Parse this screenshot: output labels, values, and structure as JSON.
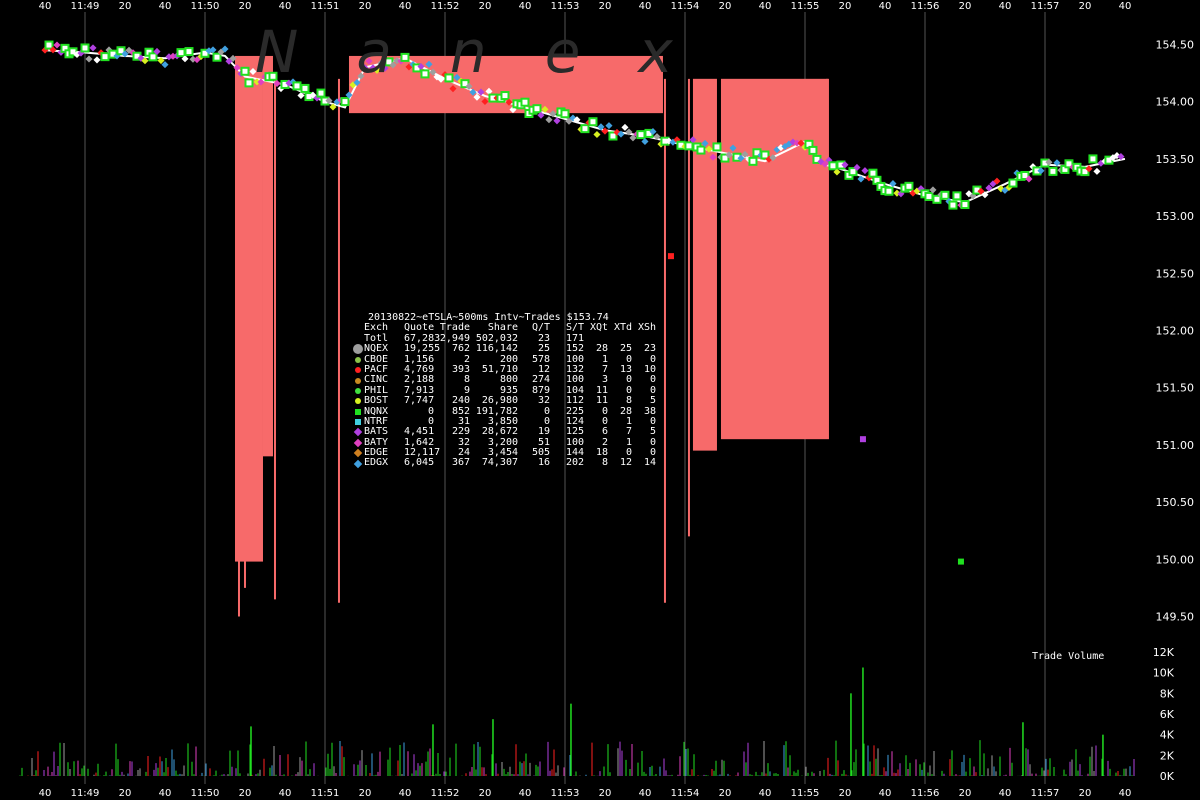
{
  "watermark": "Nanex",
  "volume_label": "Trade Volume",
  "x_ticks": [
    "40",
    "11:49",
    "20",
    "40",
    "11:50",
    "20",
    "40",
    "11:51",
    "20",
    "40",
    "11:52",
    "20",
    "40",
    "11:53",
    "20",
    "40",
    "11:54",
    "20",
    "40",
    "11:55",
    "20",
    "40",
    "11:56",
    "20",
    "40",
    "11:57",
    "20",
    "40"
  ],
  "price_ticks": [
    "154.50",
    "154.00",
    "153.50",
    "153.00",
    "152.50",
    "152.00",
    "151.50",
    "151.00",
    "150.50",
    "150.00",
    "149.50"
  ],
  "volume_ticks": [
    "12K",
    "10K",
    "8K",
    "6K",
    "4K",
    "2K",
    "0K"
  ],
  "stats": {
    "title": "20130822~eTSLA~500ms Intv~Trades $153.74",
    "header": [
      "Exch",
      "Quote",
      "Trade",
      "Share",
      "Q/T",
      "S/T",
      "XQt",
      "XTd",
      "XSh"
    ],
    "rows": [
      {
        "icon": "none",
        "color": "",
        "cells": [
          "Totl",
          "67,283",
          "2,949",
          "502,032",
          "23",
          "171",
          "",
          "",
          ""
        ]
      },
      {
        "icon": "circle-large",
        "color": "#9e9e9e",
        "cells": [
          "NQEX",
          "19,255",
          "762",
          "116,142",
          "25",
          "152",
          "28",
          "25",
          "23"
        ]
      },
      {
        "icon": "circle",
        "color": "#8bc34a",
        "cells": [
          "CBOE",
          "1,156",
          "2",
          "200",
          "578",
          "100",
          "1",
          "0",
          "0"
        ]
      },
      {
        "icon": "circle",
        "color": "#ff2020",
        "cells": [
          "PACF",
          "4,769",
          "393",
          "51,710",
          "12",
          "132",
          "7",
          "13",
          "10"
        ]
      },
      {
        "icon": "circle",
        "color": "#c88a20",
        "cells": [
          "CINC",
          "2,188",
          "8",
          "800",
          "274",
          "100",
          "3",
          "0",
          "0"
        ]
      },
      {
        "icon": "circle",
        "color": "#40e040",
        "cells": [
          "PHIL",
          "7,913",
          "9",
          "935",
          "879",
          "104",
          "11",
          "0",
          "0"
        ]
      },
      {
        "icon": "circle",
        "color": "#d8f020",
        "cells": [
          "BOST",
          "7,747",
          "240",
          "26,980",
          "32",
          "112",
          "11",
          "8",
          "5"
        ]
      },
      {
        "icon": "square",
        "color": "#20e020",
        "cells": [
          "NQNX",
          "0",
          "852",
          "191,782",
          "0",
          "225",
          "0",
          "28",
          "38"
        ]
      },
      {
        "icon": "square",
        "color": "#40d0e0",
        "cells": [
          "NTRF",
          "0",
          "31",
          "3,850",
          "0",
          "124",
          "0",
          "1",
          "0"
        ]
      },
      {
        "icon": "diamond",
        "color": "#b040e0",
        "cells": [
          "BATS",
          "4,451",
          "229",
          "28,672",
          "19",
          "125",
          "6",
          "7",
          "5"
        ]
      },
      {
        "icon": "diamond",
        "color": "#e040c0",
        "cells": [
          "BATY",
          "1,642",
          "32",
          "3,200",
          "51",
          "100",
          "2",
          "1",
          "0"
        ]
      },
      {
        "icon": "diamond",
        "color": "#d08020",
        "cells": [
          "EDGE",
          "12,117",
          "24",
          "3,454",
          "505",
          "144",
          "18",
          "0",
          "0"
        ]
      },
      {
        "icon": "diamond",
        "color": "#40a0e0",
        "cells": [
          "EDGX",
          "6,045",
          "367",
          "74,307",
          "16",
          "202",
          "8",
          "12",
          "14"
        ]
      }
    ]
  },
  "chart_data": {
    "type": "scatter",
    "symbol": "TSLA",
    "date": "20130822",
    "interval": "500ms",
    "x_unit": "time (11:48:40 to 11:57:40)",
    "ylim_price": [
      149.4,
      154.6
    ],
    "ylim_volume": [
      0,
      12000
    ],
    "colors": {
      "spread_fill": "#f76a6a",
      "quote_line": "#ffffff",
      "trade": "#20e020",
      "grid": "#555555"
    },
    "price_path": [
      [
        "11:48:40",
        154.45
      ],
      [
        "11:49:00",
        154.43
      ],
      [
        "11:49:20",
        154.4
      ],
      [
        "11:49:40",
        154.38
      ],
      [
        "11:50:00",
        154.43
      ],
      [
        "11:50:10",
        154.4
      ],
      [
        "11:50:20",
        154.22
      ],
      [
        "11:50:40",
        154.15
      ],
      [
        "11:51:00",
        154.0
      ],
      [
        "11:51:10",
        153.95
      ],
      [
        "11:51:20",
        154.3
      ],
      [
        "11:51:40",
        154.38
      ],
      [
        "11:52:00",
        154.2
      ],
      [
        "11:52:20",
        154.05
      ],
      [
        "11:52:40",
        153.95
      ],
      [
        "11:53:00",
        153.85
      ],
      [
        "11:53:20",
        153.75
      ],
      [
        "11:53:40",
        153.7
      ],
      [
        "11:54:00",
        153.62
      ],
      [
        "11:54:20",
        153.55
      ],
      [
        "11:54:40",
        153.48
      ],
      [
        "11:55:00",
        153.65
      ],
      [
        "11:55:10",
        153.45
      ],
      [
        "11:55:20",
        153.4
      ],
      [
        "11:55:40",
        153.28
      ],
      [
        "11:56:00",
        153.18
      ],
      [
        "11:56:20",
        153.12
      ],
      [
        "11:56:40",
        153.28
      ],
      [
        "11:57:00",
        153.45
      ],
      [
        "11:57:20",
        153.43
      ],
      [
        "11:57:40",
        153.5
      ]
    ],
    "spread_blocks": [
      {
        "from": "11:50:15",
        "to": "11:50:29",
        "high": 154.4,
        "low": 149.98
      },
      {
        "from": "11:50:29",
        "to": "11:50:34",
        "high": 154.4,
        "low": 150.9
      },
      {
        "from": "11:51:12",
        "to": "11:53:49",
        "high": 154.4,
        "low": 153.9
      },
      {
        "from": "11:54:04",
        "to": "11:54:16",
        "high": 154.2,
        "low": 150.95
      },
      {
        "from": "11:54:18",
        "to": "11:55:12",
        "high": 154.2,
        "low": 151.05
      }
    ],
    "spikes": [
      {
        "t": "11:50:17",
        "low": 149.5
      },
      {
        "t": "11:50:20",
        "low": 149.75
      },
      {
        "t": "11:50:35",
        "low": 149.65
      },
      {
        "t": "11:51:07",
        "low": 149.62
      },
      {
        "t": "11:53:50",
        "low": 149.62
      },
      {
        "t": "11:54:02",
        "low": 150.2
      },
      {
        "t": "11:55:11",
        "low": 151.25
      }
    ],
    "outlier_trades": [
      {
        "t": "11:56:18",
        "price": 149.98,
        "color": "#20e020"
      },
      {
        "t": "11:55:29",
        "price": 151.05,
        "color": "#b040e0"
      },
      {
        "t": "11:53:53",
        "price": 152.65,
        "color": "#ff2020"
      }
    ],
    "volume_peaks": [
      {
        "t": "11:55:29",
        "value": 10500
      },
      {
        "t": "11:55:23",
        "value": 8000
      },
      {
        "t": "11:53:03",
        "value": 7000
      },
      {
        "t": "11:52:24",
        "value": 5500
      },
      {
        "t": "11:51:54",
        "value": 5000
      },
      {
        "t": "11:50:23",
        "value": 4800
      },
      {
        "t": "11:56:49",
        "value": 5200
      },
      {
        "t": "11:57:29",
        "value": 4000
      }
    ]
  }
}
